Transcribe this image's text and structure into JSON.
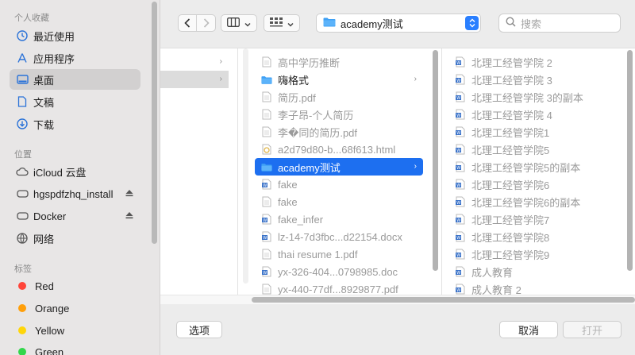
{
  "sidebar": {
    "favorites_header": "个人收藏",
    "favorites": [
      {
        "label": "最近使用",
        "icon": "clock-icon"
      },
      {
        "label": "应用程序",
        "icon": "applications-icon"
      },
      {
        "label": "桌面",
        "icon": "desktop-icon"
      },
      {
        "label": "文稿",
        "icon": "document-icon"
      },
      {
        "label": "下载",
        "icon": "download-icon"
      }
    ],
    "locations_header": "位置",
    "locations": [
      {
        "label": "iCloud 云盘",
        "icon": "cloud-icon"
      },
      {
        "label": "hgspdfzhq_install",
        "icon": "drive-icon"
      },
      {
        "label": "Docker",
        "icon": "drive-icon"
      },
      {
        "label": "网络",
        "icon": "network-icon"
      }
    ],
    "tags_header": "标签",
    "tags": [
      {
        "label": "Red",
        "color": "#ff453a"
      },
      {
        "label": "Orange",
        "color": "#ff9f0a"
      },
      {
        "label": "Yellow",
        "color": "#ffd60a"
      },
      {
        "label": "Green",
        "color": "#32d74b"
      }
    ]
  },
  "toolbar": {
    "path_label": "academy测试",
    "search_placeholder": "搜索"
  },
  "columns": {
    "col2": [
      {
        "label": "高中学历推断",
        "type": "doc"
      },
      {
        "label": "嗨格式",
        "type": "folder"
      },
      {
        "label": "简历.pdf",
        "type": "doc"
      },
      {
        "label": "李子昂-个人简历",
        "type": "doc"
      },
      {
        "label": "李�同的简历.pdf",
        "type": "doc"
      },
      {
        "label": "a2d79d80-b...68f613.html",
        "type": "html"
      },
      {
        "label": "academy测试",
        "type": "folder-selected"
      },
      {
        "label": "fake",
        "type": "word"
      },
      {
        "label": "fake",
        "type": "doc"
      },
      {
        "label": "fake_infer",
        "type": "word"
      },
      {
        "label": "lz-14-7d3fbc...d22154.docx",
        "type": "word"
      },
      {
        "label": "thai resume 1.pdf",
        "type": "doc"
      },
      {
        "label": "yx-326-404...0798985.doc",
        "type": "word"
      },
      {
        "label": "yx-440-77df...8929877.pdf",
        "type": "doc"
      }
    ],
    "col3": [
      "北理工经管学院 2",
      "北理工经管学院 3",
      "北理工经管学院 3的副本",
      "北理工经管学院 4",
      "北理工经管学院1",
      "北理工经管学院5",
      "北理工经管学院5的副本",
      "北理工经管学院6",
      "北理工经管学院6的副本",
      "北理工经管学院7",
      "北理工经管学院8",
      "北理工经管学院9",
      "成人教育",
      "成人教育 2"
    ]
  },
  "footer": {
    "options_label": "选项",
    "cancel_label": "取消",
    "open_label": "打开"
  },
  "colors": {
    "accent": "#1d6ff0",
    "folder": "#3ea0f5"
  }
}
